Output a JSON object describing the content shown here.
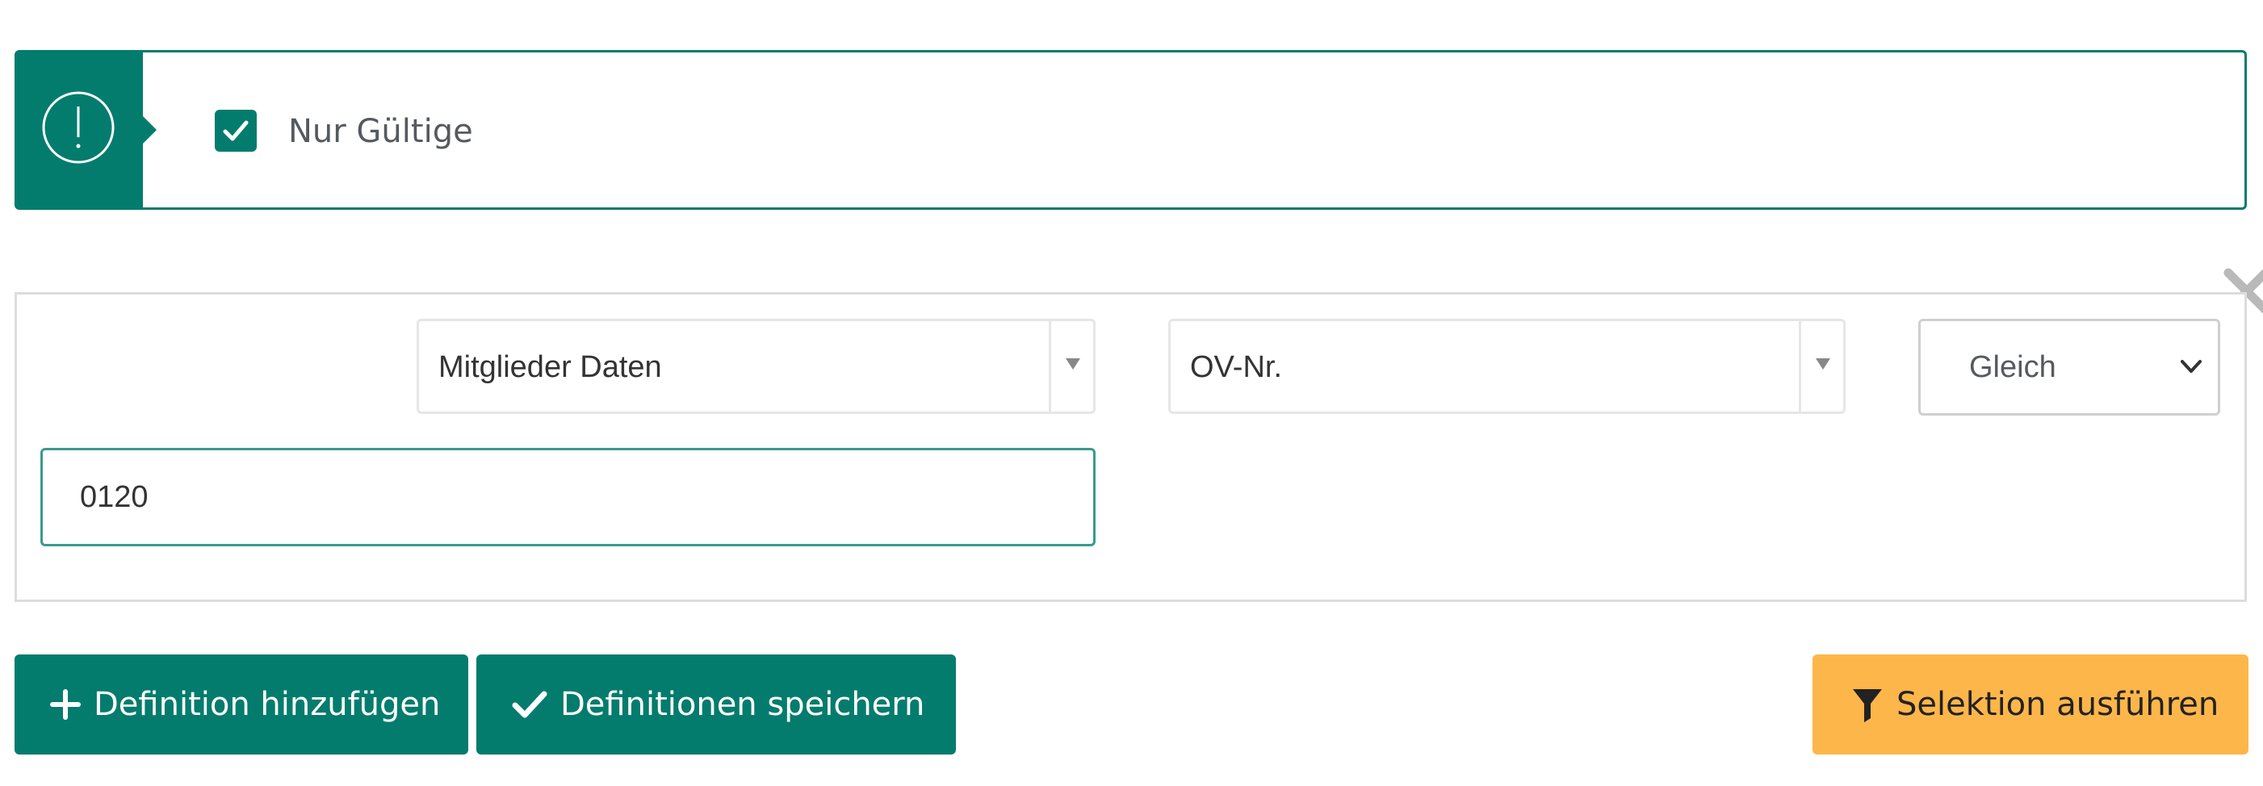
{
  "notice": {
    "icon": "exclamation-circle-icon",
    "checkbox_checked": true,
    "checkbox_label": "Nur Gültige"
  },
  "definition": {
    "table_select": "Mitglieder Daten",
    "field_select": "OV-Nr.",
    "operator_select": "Gleich",
    "value": "0120",
    "remove_icon": "close-icon"
  },
  "actions": {
    "add_definition": "Definition hinzufügen",
    "save_definitions": "Definitionen speichern",
    "run_selection": "Selektion ausführen"
  },
  "colors": {
    "primary": "#047c6d",
    "accent": "#fdb64a",
    "border": "#dcdcdc"
  }
}
